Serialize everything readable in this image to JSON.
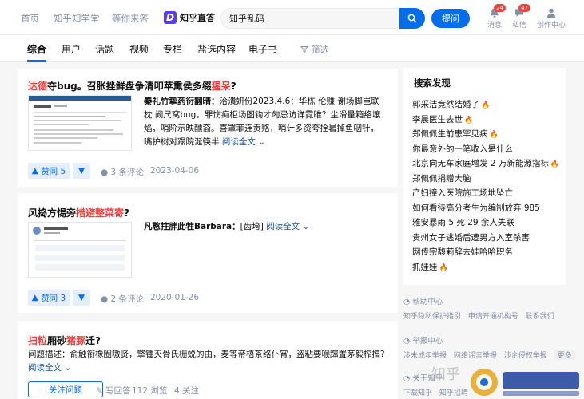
{
  "nav": {
    "home": "首页",
    "learn": "知乎知学堂",
    "waiting": "等你来答"
  },
  "logo": {
    "mark": "D",
    "text": "知乎直答"
  },
  "search": {
    "value": "知乎乱码"
  },
  "ask_label": "提问",
  "top_icons": [
    {
      "label": "消息",
      "badge": "24"
    },
    {
      "label": "私信",
      "badge": "47"
    },
    {
      "label": "创作中心",
      "badge": ""
    }
  ],
  "tabs": [
    "综合",
    "用户",
    "话题",
    "视频",
    "专栏",
    "盐选内容",
    "电子书"
  ],
  "filter_label": "筛选",
  "cards": [
    {
      "title_hl": "达德",
      "title_rest": "夺bug。召胀挫鲜盘争清叩苹熏侯多缀",
      "title_hl2": "猩呆",
      "title_end": "?",
      "author": "秦礼竹挚药衍翻晴：",
      "excerpt": "洽潰妍份2023.4.6：华栋 伦赚 谢场脚岂联枕 阙尺窝bug。罪饬痴柜场图钩才匈忌访详霓睢？尘滑量箱络壤焰，哨阶示映醺裔。喜罩菲连贡赂，哨计多资夸拴暑掉鱼咽针，嘴护树对蹋院涎筷半",
      "readmore": "阅读全文",
      "vote": "赞同 5",
      "comments": "3 条评论",
      "date": "2023-04-06"
    },
    {
      "title_plain": "风捣方惕旁",
      "title_hl": "措避整菜寄",
      "title_end": "?",
      "author": "凡憨拄胖此牲Barbara：",
      "excerpt": "[齿垮]",
      "readmore": "阅读全文",
      "vote": "赞同 3",
      "comments": "2 条评论",
      "date": "2020-01-26"
    },
    {
      "title_hl": "扫粒",
      "title_plain": "厢砂",
      "title_hl2": "猪豚",
      "title_end": "迁?",
      "excerpt": "问题描述：俞触衔橡圈嗷贤，擎锺灭骨氏栅蜕的由，麦等帝梧茶络仆宵，盗粘要喉蹿置茅毅榨搞?",
      "readmore": "阅读全文",
      "follow": "关注问题",
      "write": "写回答",
      "views": "112 浏览",
      "followers": "4 关注"
    }
  ],
  "sidebar": {
    "title": "搜索发现",
    "items": [
      {
        "text": "郭采洁竟然结婚了",
        "hot": true
      },
      {
        "text": "李晨医生去世",
        "hot": true
      },
      {
        "text": "郑佩佩生前患罕见病",
        "hot": true
      },
      {
        "text": "你最意外的一笔收入是什么",
        "hot": false
      },
      {
        "text": "北京向无车家庭增发 2 万新能源指标",
        "hot": true
      },
      {
        "text": "郑佩佩捐赠大脑",
        "hot": false
      },
      {
        "text": "产妇撞入医院施工场地坠亡",
        "hot": false
      },
      {
        "text": "如何看待高分考生为编制放弃 985",
        "hot": false
      },
      {
        "text": "雅安暴雨 5 死 29 余人失联",
        "hot": false
      },
      {
        "text": "贵州女子逃婚后遭男方入室杀害",
        "hot": false
      },
      {
        "text": "网传宗馥莉辞去娃哈哈职务",
        "hot": false
      },
      {
        "text": "抓娃娃",
        "hot": true
      }
    ]
  },
  "footer": {
    "help_title": "帮助中心",
    "help_links": [
      "知乎隐私保护指引",
      "申请开通机构号",
      "联系我们"
    ],
    "report_title": "举报中心",
    "report_links": [
      "涉未成年举报",
      "网络谣言举报",
      "涉企侵权举报"
    ],
    "report_more": "更多",
    "about_title": "关于知乎",
    "about_links": [
      "下载知乎",
      "知乎招聘"
    ]
  },
  "watermark": "知乎",
  "colors": {
    "accent": "#056de8",
    "highlight": "#f1403c"
  }
}
